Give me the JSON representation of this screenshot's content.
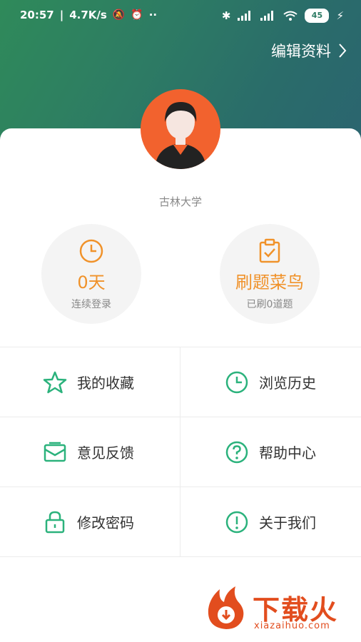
{
  "status": {
    "time": "20:57",
    "speed": "4.7K/s",
    "battery": "45"
  },
  "header": {
    "edit_label": "编辑资料"
  },
  "profile": {
    "school": "古林大学"
  },
  "stats": {
    "login": {
      "value": "0天",
      "label": "连续登录"
    },
    "rank": {
      "value": "刷题菜鸟",
      "label": "已刷0道题"
    }
  },
  "menu": [
    {
      "label": "我的收藏",
      "icon": "star-icon"
    },
    {
      "label": "浏览历史",
      "icon": "clock-icon"
    },
    {
      "label": "意见反馈",
      "icon": "envelope-icon"
    },
    {
      "label": "帮助中心",
      "icon": "question-icon"
    },
    {
      "label": "修改密码",
      "icon": "lock-icon"
    },
    {
      "label": "关于我们",
      "icon": "exclamation-icon"
    }
  ],
  "colors": {
    "accent_green": "#2bb27c",
    "accent_orange": "#f0922a",
    "avatar_bg": "#f2622e"
  },
  "watermark": {
    "brand": "下载火",
    "domain": "xiazaihuo.com"
  }
}
